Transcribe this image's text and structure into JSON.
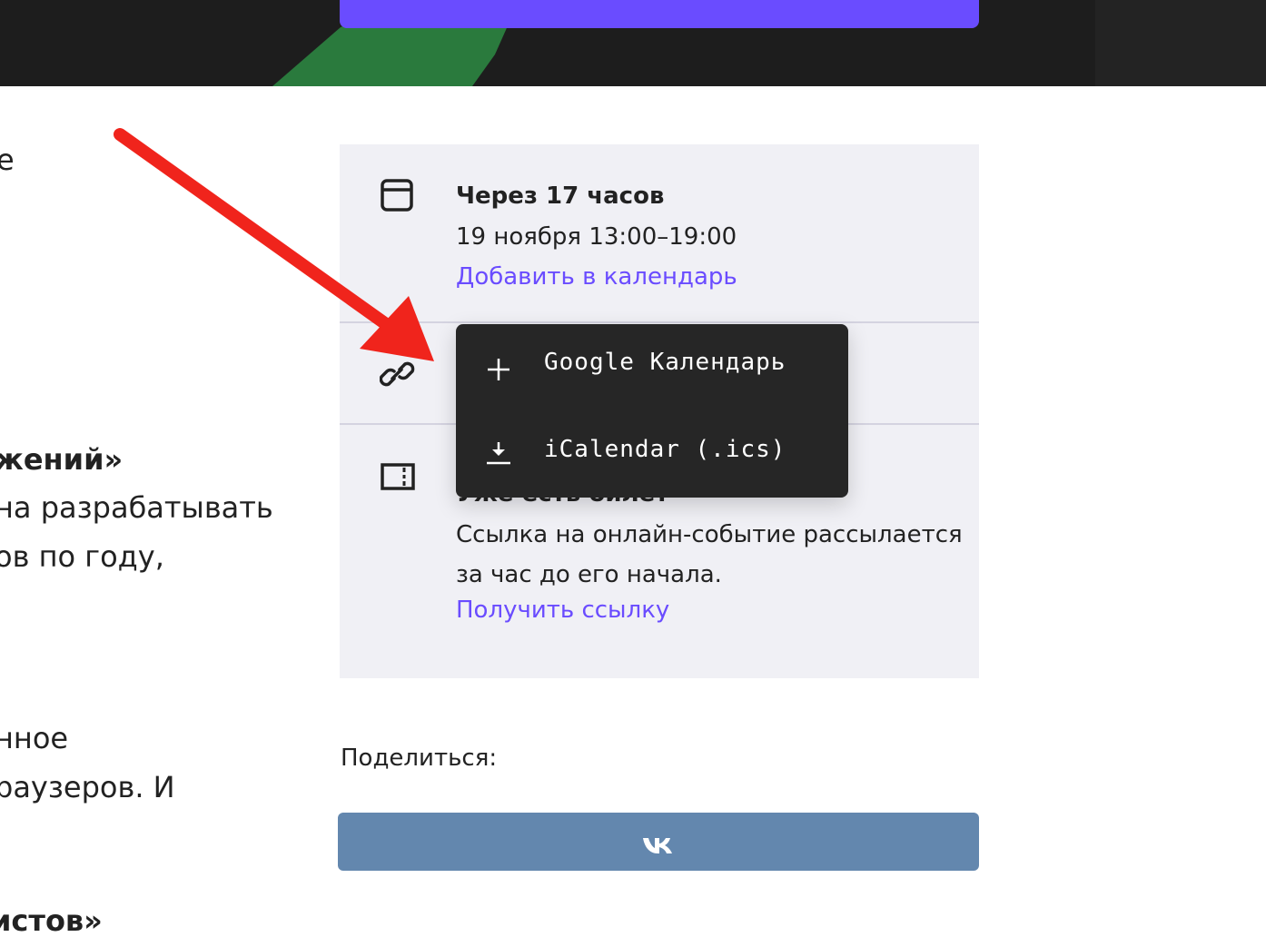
{
  "article": {
    "lines": [
      {
        "text": "е",
        "bold": false
      },
      {
        "text": "жений»",
        "bold": true
      },
      {
        "text": "на разрабатывать",
        "bold": false
      },
      {
        "text": "ов по году,",
        "bold": false
      },
      {
        "text": "нное",
        "bold": false
      },
      {
        "text": "раузеров. И",
        "bold": false
      },
      {
        "text": "истов»",
        "bold": true
      }
    ]
  },
  "event": {
    "when_title": "Через 17 часов",
    "when_date": "19 ноября 13:00–19:00",
    "add_calendar_link": "Добавить в календарь",
    "online_title": "Уже есть билет",
    "online_text": "Ссылка на онлайн-событие рассылается за час до его начала.",
    "get_link": "Получить ссылку",
    "icons": [
      "calendar-icon",
      "link-icon",
      "ticket-icon"
    ]
  },
  "calendar_menu": {
    "items": [
      {
        "label": "Google Календарь",
        "icon": "plus-icon"
      },
      {
        "label": "iCalendar (.ics)",
        "icon": "download-icon"
      }
    ]
  },
  "share": {
    "label": "Поделиться:",
    "vk_icon": "vk-logo-icon"
  },
  "colors": {
    "accent": "#6a4cff",
    "card_bg": "#f0f0f5",
    "popup_bg": "#262626",
    "vk_button": "#6387ae",
    "annotation_arrow": "#f0241c",
    "hero_bg": "#1d1d1d",
    "hero_shape": "#2a7a3d"
  }
}
